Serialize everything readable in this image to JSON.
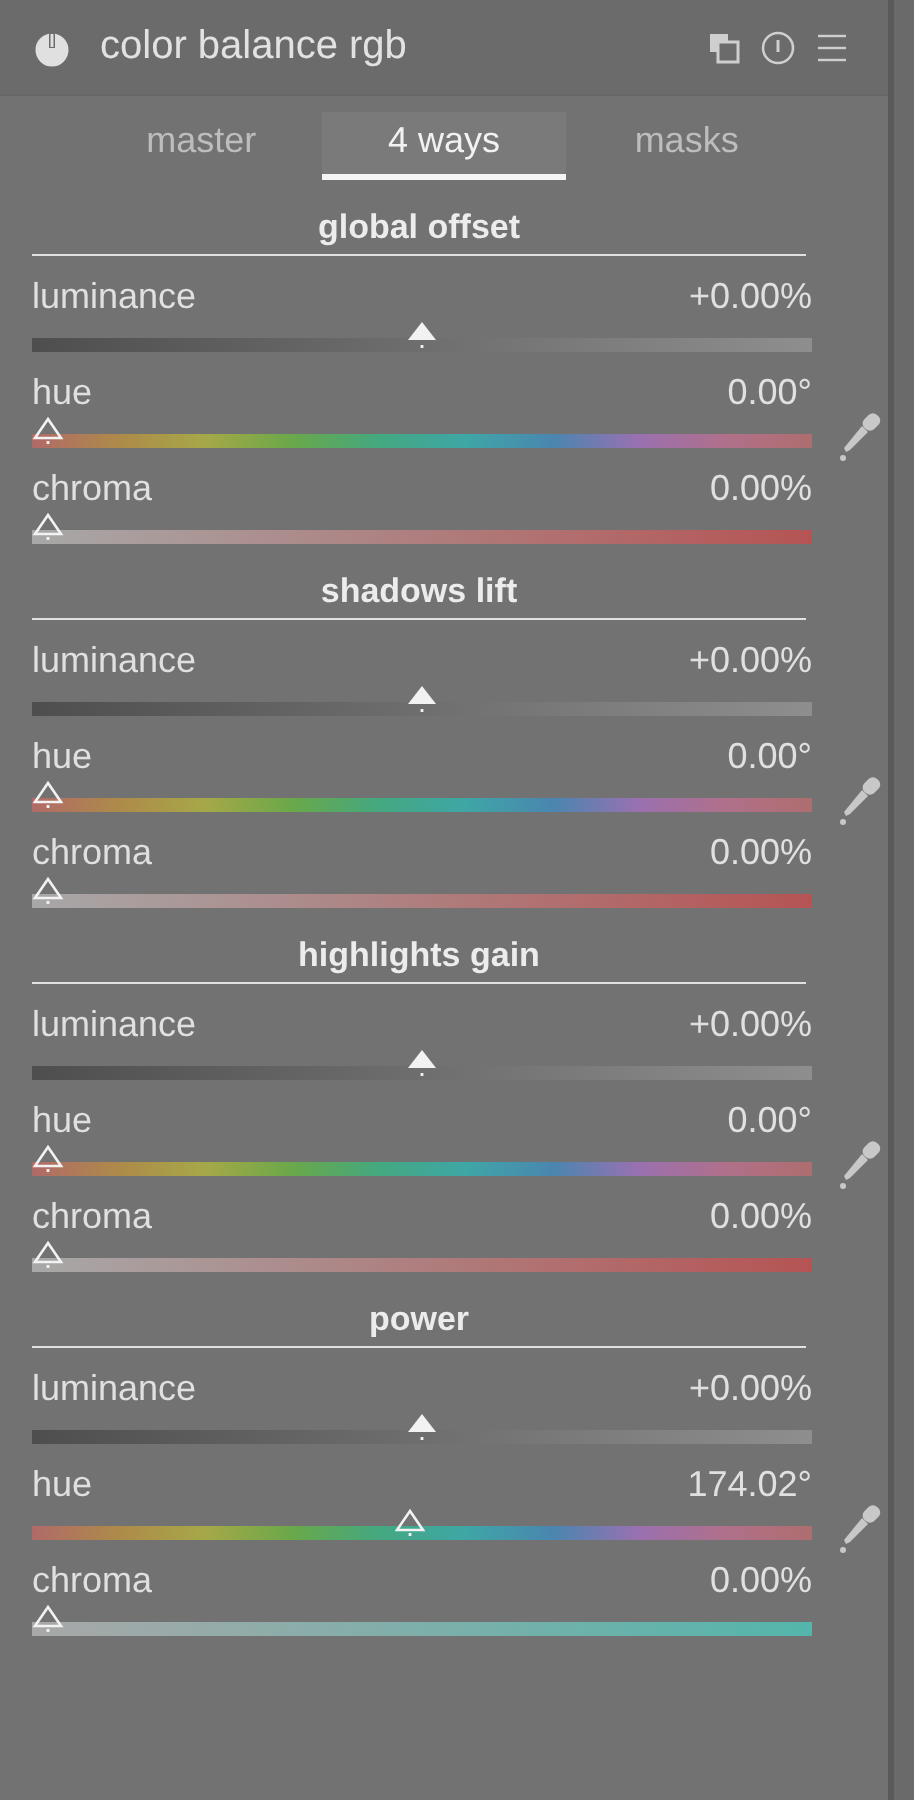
{
  "module": {
    "title": "color balance rgb",
    "enabled": true
  },
  "tabs": [
    {
      "label": "master",
      "selected": false
    },
    {
      "label": "4 ways",
      "selected": true
    },
    {
      "label": "masks",
      "selected": false
    }
  ],
  "sections": [
    {
      "heading": "global offset",
      "sliders": [
        {
          "kind": "luminance",
          "label": "luminance",
          "value": "+0.00%",
          "level": 0.5
        },
        {
          "kind": "hue",
          "label": "hue",
          "value": "0.00°",
          "level": 0
        },
        {
          "kind": "chroma",
          "label": "chroma",
          "value": "0.00%",
          "level": 0
        }
      ]
    },
    {
      "heading": "shadows lift",
      "sliders": [
        {
          "kind": "luminance",
          "label": "luminance",
          "value": "+0.00%",
          "level": 0.5
        },
        {
          "kind": "hue",
          "label": "hue",
          "value": "0.00°",
          "level": 0
        },
        {
          "kind": "chroma",
          "label": "chroma",
          "value": "0.00%",
          "level": 0
        }
      ]
    },
    {
      "heading": "highlights gain",
      "sliders": [
        {
          "kind": "luminance",
          "label": "luminance",
          "value": "+0.00%",
          "level": 0.5
        },
        {
          "kind": "hue",
          "label": "hue",
          "value": "0.00°",
          "level": 0
        },
        {
          "kind": "chroma",
          "label": "chroma",
          "value": "0.00%",
          "level": 0
        }
      ]
    },
    {
      "heading": "power",
      "sliders": [
        {
          "kind": "luminance",
          "label": "luminance",
          "value": "+0.00%",
          "level": 0.5
        },
        {
          "kind": "hue",
          "label": "hue",
          "value": "174.02°",
          "level": 0.4834
        },
        {
          "kind": "chroma",
          "label": "chroma",
          "value": "0.00%",
          "level": 0
        }
      ]
    }
  ]
}
